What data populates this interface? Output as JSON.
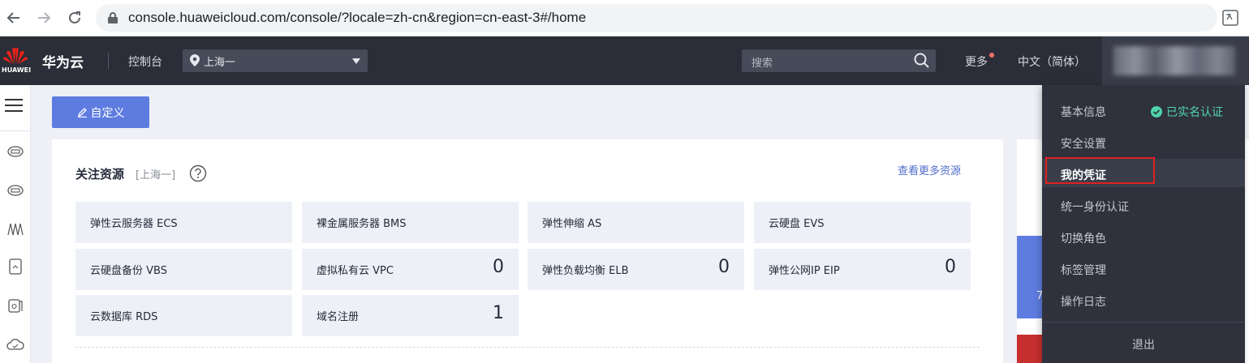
{
  "browser": {
    "url": "console.huaweicloud.com/console/?locale=zh-cn&region=cn-east-3#/home"
  },
  "topnav": {
    "logo_text": "HUAWEI",
    "brand": "华为云",
    "console": "控制台",
    "region": "上海一",
    "search_placeholder": "搜索",
    "more": "更多",
    "language": "中文（简体）"
  },
  "main": {
    "custom_button": "自定义",
    "card": {
      "title": "关注资源",
      "region_tag": "[上海一]",
      "more_link": "查看更多资源",
      "tiles": [
        {
          "name": "弹性云服务器 ECS",
          "count": ""
        },
        {
          "name": "裸金属服务器 BMS",
          "count": ""
        },
        {
          "name": "弹性伸缩 AS",
          "count": ""
        },
        {
          "name": "云硬盘 EVS",
          "count": ""
        },
        {
          "name": "云硬盘备份 VBS",
          "count": ""
        },
        {
          "name": "虚拟私有云 VPC",
          "count": "0"
        },
        {
          "name": "弹性负载均衡 ELB",
          "count": "0"
        },
        {
          "name": "弹性公网IP EIP",
          "count": "0"
        },
        {
          "name": "云数据库 RDS",
          "count": ""
        },
        {
          "name": "域名注册",
          "count": "1"
        }
      ]
    },
    "right_panel_partial": "7"
  },
  "dropdown": {
    "items": [
      "基本信息",
      "安全设置",
      "我的凭证",
      "统一身份认证",
      "切换角色",
      "标签管理",
      "操作日志"
    ],
    "verified": "已实名认证",
    "logout": "退出"
  },
  "colors": {
    "nav_bg": "#2b2d38",
    "accent": "#5e7ce0",
    "verified": "#50d4ab",
    "highlight": "#e02020"
  }
}
